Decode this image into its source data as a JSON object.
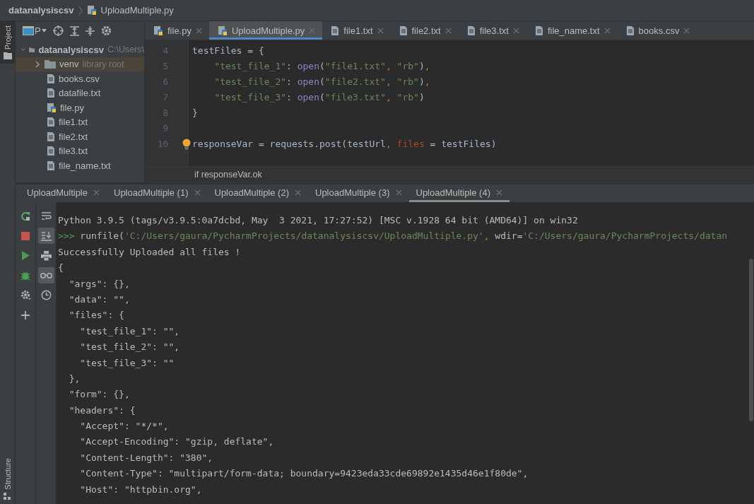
{
  "breadcrumb": [
    {
      "label": "datanalysiscsv",
      "kind": "project"
    },
    {
      "label": "UploadMultiple.py",
      "kind": "python"
    }
  ],
  "side_tabs_top": [
    {
      "label": "Project",
      "selected": true
    }
  ],
  "side_tabs_bottom": [
    {
      "label": "Structure",
      "selected": false
    }
  ],
  "project_panel": {
    "view": "P",
    "tree": [
      {
        "label": "datanalysiscsv",
        "hint": "C:\\Users\\",
        "kind": "folder",
        "expanded": true,
        "selected": false,
        "children": [
          {
            "label": "venv",
            "hint": "library root",
            "kind": "folder",
            "expanded": false,
            "selected": true
          },
          {
            "label": "books.csv",
            "kind": "text",
            "selected": false
          },
          {
            "label": "datafile.txt",
            "kind": "text",
            "selected": false
          },
          {
            "label": "file.py",
            "kind": "python",
            "selected": false
          },
          {
            "label": "file1.txt",
            "kind": "text",
            "selected": false
          },
          {
            "label": "file2.txt",
            "kind": "text",
            "selected": false
          },
          {
            "label": "file3.txt",
            "kind": "text",
            "selected": false
          },
          {
            "label": "file_name.txt",
            "kind": "text",
            "selected": false
          }
        ]
      }
    ]
  },
  "editor_tabs": [
    {
      "label": "file.py",
      "kind": "python",
      "selected": false
    },
    {
      "label": "UploadMultiple.py",
      "kind": "python",
      "selected": true
    },
    {
      "label": "file1.txt",
      "kind": "text",
      "selected": false
    },
    {
      "label": "file2.txt",
      "kind": "text",
      "selected": false
    },
    {
      "label": "file3.txt",
      "kind": "text",
      "selected": false
    },
    {
      "label": "file_name.txt",
      "kind": "text",
      "selected": false
    },
    {
      "label": "books.csv",
      "kind": "text",
      "selected": false
    }
  ],
  "code_lines": [
    {
      "number": "4",
      "tokens": [
        {
          "text": "testFiles = {",
          "kind": "plain"
        }
      ]
    },
    {
      "number": "5",
      "tokens": [
        {
          "text": "    \"test_file_1\"",
          "kind": "string"
        },
        {
          "text": ": ",
          "kind": "plain"
        },
        {
          "text": "open",
          "kind": "builtin"
        },
        {
          "text": "(",
          "kind": "plain"
        },
        {
          "text": "\"file1.txt\"",
          "kind": "string"
        },
        {
          "text": ", ",
          "kind": "punct"
        },
        {
          "text": "\"rb\"",
          "kind": "string"
        },
        {
          "text": ")",
          "kind": "plain"
        },
        {
          "text": ",",
          "kind": "punct"
        }
      ]
    },
    {
      "number": "6",
      "tokens": [
        {
          "text": "    \"test_file_2\"",
          "kind": "string"
        },
        {
          "text": ": ",
          "kind": "plain"
        },
        {
          "text": "open",
          "kind": "builtin"
        },
        {
          "text": "(",
          "kind": "plain"
        },
        {
          "text": "\"file2.txt\"",
          "kind": "string"
        },
        {
          "text": ", ",
          "kind": "punct"
        },
        {
          "text": "\"rb\"",
          "kind": "string"
        },
        {
          "text": ")",
          "kind": "plain"
        },
        {
          "text": ",",
          "kind": "punct"
        }
      ]
    },
    {
      "number": "7",
      "tokens": [
        {
          "text": "    \"test_file_3\"",
          "kind": "string"
        },
        {
          "text": ": ",
          "kind": "plain"
        },
        {
          "text": "open",
          "kind": "builtin"
        },
        {
          "text": "(",
          "kind": "plain"
        },
        {
          "text": "\"file3.txt\"",
          "kind": "string"
        },
        {
          "text": ", ",
          "kind": "punct"
        },
        {
          "text": "\"rb\"",
          "kind": "string"
        },
        {
          "text": ")",
          "kind": "plain"
        }
      ]
    },
    {
      "number": "8",
      "tokens": [
        {
          "text": "}",
          "kind": "plain"
        }
      ]
    },
    {
      "number": "9"
    },
    {
      "number": "10",
      "intention_bulb": true,
      "tokens": [
        {
          "text": "responseVar = requests.post(testUrl",
          "kind": "plain"
        },
        {
          "text": ", ",
          "kind": "punct"
        },
        {
          "text": "files",
          "kind": "param"
        },
        {
          "text": " = testFiles)",
          "kind": "plain"
        }
      ]
    }
  ],
  "breadcrumb_hint": "if responseVar.ok",
  "run_tabs": [
    {
      "label": "UploadMultiple",
      "selected": false
    },
    {
      "label": "UploadMultiple (1)",
      "selected": false
    },
    {
      "label": "UploadMultiple (2)",
      "selected": false
    },
    {
      "label": "UploadMultiple (3)",
      "selected": false
    },
    {
      "label": "UploadMultiple (4)",
      "selected": true
    }
  ],
  "console_lines": [
    {
      "tokens": [
        {
          "text": "Python 3.9.5 (tags/v3.9.5:0a7dcbd, May  3 2021, 17:27:52) [MSC v.1928 64 bit (AMD64)] on win32",
          "kind": "plain"
        }
      ]
    },
    {
      "tokens": [
        {
          "text": ">>> ",
          "kind": "prompt"
        },
        {
          "text": "runfile(",
          "kind": "plain"
        },
        {
          "text": "'C:/Users/gaura/PycharmProjects/datanalysiscsv/UploadMultiple.py'",
          "kind": "string"
        },
        {
          "text": ", ",
          "kind": "punct"
        },
        {
          "text": "wdir=",
          "kind": "plain"
        },
        {
          "text": "'C:/Users/gaura/PycharmProjects/datan",
          "kind": "string"
        }
      ]
    },
    {
      "tokens": [
        {
          "text": "Successfully Uploaded all files !",
          "kind": "plain"
        }
      ]
    },
    {
      "tokens": [
        {
          "text": "{",
          "kind": "plain"
        }
      ]
    },
    {
      "tokens": [
        {
          "text": "  \"args\": {},",
          "kind": "plain"
        }
      ]
    },
    {
      "tokens": [
        {
          "text": "  \"data\": \"\",",
          "kind": "plain"
        }
      ]
    },
    {
      "tokens": [
        {
          "text": "  \"files\": {",
          "kind": "plain"
        }
      ]
    },
    {
      "tokens": [
        {
          "text": "    \"test_file_1\": \"\",",
          "kind": "plain"
        }
      ]
    },
    {
      "tokens": [
        {
          "text": "    \"test_file_2\": \"\",",
          "kind": "plain"
        }
      ]
    },
    {
      "tokens": [
        {
          "text": "    \"test_file_3\": \"\"",
          "kind": "plain"
        }
      ]
    },
    {
      "tokens": [
        {
          "text": "  },",
          "kind": "plain"
        }
      ]
    },
    {
      "tokens": [
        {
          "text": "  \"form\": {},",
          "kind": "plain"
        }
      ]
    },
    {
      "tokens": [
        {
          "text": "  \"headers\": {",
          "kind": "plain"
        }
      ]
    },
    {
      "tokens": [
        {
          "text": "    \"Accept\": \"*/*\",",
          "kind": "plain"
        }
      ]
    },
    {
      "tokens": [
        {
          "text": "    \"Accept-Encoding\": \"gzip, deflate\",",
          "kind": "plain"
        }
      ]
    },
    {
      "tokens": [
        {
          "text": "    \"Content-Length\": \"380\",",
          "kind": "plain"
        }
      ]
    },
    {
      "tokens": [
        {
          "text": "    \"Content-Type\": \"multipart/form-data; boundary=9423eda33cde69892e1435d46e1f80de\",",
          "kind": "plain"
        }
      ]
    },
    {
      "tokens": [
        {
          "text": "    \"Host\": \"httpbin.org\",",
          "kind": "plain"
        }
      ]
    }
  ],
  "console_tools": [
    {
      "kind": "rerun",
      "active": false
    },
    {
      "kind": "stop",
      "active": false
    },
    {
      "kind": "run",
      "active": false
    },
    {
      "kind": "debug",
      "active": false
    },
    {
      "kind": "settings",
      "active": false
    },
    {
      "kind": "add",
      "active": false
    }
  ],
  "console_view_tools": [
    {
      "kind": "wrap",
      "active": false
    },
    {
      "kind": "scroll-end",
      "active": true
    },
    {
      "kind": "print",
      "active": false
    },
    {
      "kind": "glasses",
      "active": true
    },
    {
      "kind": "history",
      "active": false
    }
  ]
}
